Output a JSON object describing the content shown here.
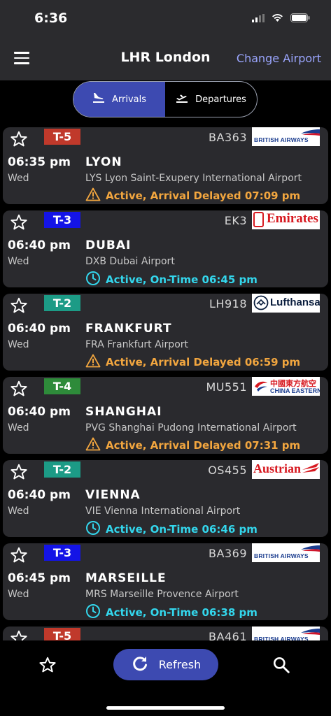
{
  "status": {
    "time": "6:36"
  },
  "nav": {
    "title": "LHR London",
    "change_label": "Change Airport"
  },
  "tabs": {
    "arrivals": "Arrivals",
    "departures": "Departures",
    "active": "arrivals"
  },
  "colors": {
    "accent": "#3d4ab1",
    "delayed": "#f2a63f",
    "ontime": "#33d6ec",
    "link": "#9ba6ff",
    "card": "#2a2a2e"
  },
  "flights": [
    {
      "terminal": "T-5",
      "terminal_color": "#c0392b",
      "flight": "BA363",
      "airline": "British Airways",
      "logo_text": "BRITISH AIRWAYS",
      "time": "06:35 pm",
      "day": "Wed",
      "city": "LYON",
      "airport": "LYS Lyon Saint-Exupery International Airport",
      "status_type": "delayed",
      "status": "Active, Arrival Delayed 07:09 pm"
    },
    {
      "terminal": "T-3",
      "terminal_color": "#1414e6",
      "flight": "EK3",
      "airline": "Emirates",
      "logo_text": "Emirates",
      "time": "06:40 pm",
      "day": "Wed",
      "city": "DUBAI",
      "airport": "DXB Dubai Airport",
      "status_type": "ontime",
      "status": "Active, On-Time 06:45 pm"
    },
    {
      "terminal": "T-2",
      "terminal_color": "#1c9b86",
      "flight": "LH918",
      "airline": "Lufthansa",
      "logo_text": "Lufthansa",
      "time": "06:40 pm",
      "day": "Wed",
      "city": "FRANKFURT",
      "airport": "FRA Frankfurt Airport",
      "status_type": "delayed",
      "status": "Active, Arrival Delayed 06:59 pm"
    },
    {
      "terminal": "T-4",
      "terminal_color": "#2e8b3a",
      "flight": "MU551",
      "airline": "China Eastern",
      "logo_text": "CHINA EASTERN",
      "logo_text_cn": "中國東方航空",
      "time": "06:40 pm",
      "day": "Wed",
      "city": "SHANGHAI",
      "airport": "PVG Shanghai Pudong International Airport",
      "status_type": "delayed",
      "status": "Active, Arrival Delayed 07:31 pm"
    },
    {
      "terminal": "T-2",
      "terminal_color": "#1c9b86",
      "flight": "OS455",
      "airline": "Austrian",
      "logo_text": "Austrian",
      "time": "06:40 pm",
      "day": "Wed",
      "city": "VIENNA",
      "airport": "VIE Vienna International Airport",
      "status_type": "ontime",
      "status": "Active, On-Time 06:46 pm"
    },
    {
      "terminal": "T-3",
      "terminal_color": "#1414e6",
      "flight": "BA369",
      "airline": "British Airways",
      "logo_text": "BRITISH AIRWAYS",
      "time": "06:45 pm",
      "day": "Wed",
      "city": "MARSEILLE",
      "airport": "MRS Marseille Provence Airport",
      "status_type": "ontime",
      "status": "Active, On-Time 06:38 pm"
    },
    {
      "terminal": "T-5",
      "terminal_color": "#c0392b",
      "flight": "BA461",
      "airline": "British Airways",
      "logo_text": "BRITISH AIRWAYS",
      "time": "",
      "day": "",
      "city": "",
      "airport": "",
      "status_type": "",
      "status": ""
    }
  ],
  "bottom": {
    "refresh_label": "Refresh"
  }
}
